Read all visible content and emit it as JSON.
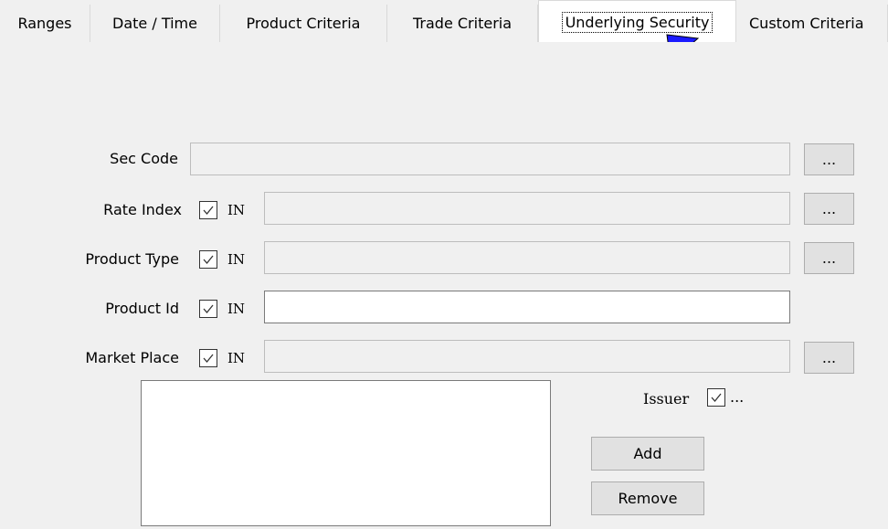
{
  "tabs": [
    {
      "label": "Ranges"
    },
    {
      "label": "Date / Time"
    },
    {
      "label": "Product Criteria"
    },
    {
      "label": "Trade Criteria"
    },
    {
      "label": "Underlying Security",
      "active": true
    },
    {
      "label": "Custom Criteria"
    }
  ],
  "form": {
    "sec_code": {
      "label": "Sec Code",
      "value": "",
      "browse": "..."
    },
    "rate_index": {
      "label": "Rate Index",
      "checked": true,
      "in_label": "IN",
      "value": "",
      "browse": "..."
    },
    "product_type": {
      "label": "Product Type",
      "checked": true,
      "in_label": "IN",
      "value": "",
      "browse": "..."
    },
    "product_id": {
      "label": "Product Id",
      "checked": true,
      "in_label": "IN",
      "value": ""
    },
    "market_place": {
      "label": "Market Place",
      "checked": true,
      "in_label": "IN",
      "value": "",
      "browse": "..."
    }
  },
  "issuer": {
    "label": "Issuer",
    "checked": true,
    "browse": "..."
  },
  "buttons": {
    "add": "Add",
    "remove": "Remove"
  },
  "annotation": {
    "arrow_color": "#1a1aff"
  }
}
